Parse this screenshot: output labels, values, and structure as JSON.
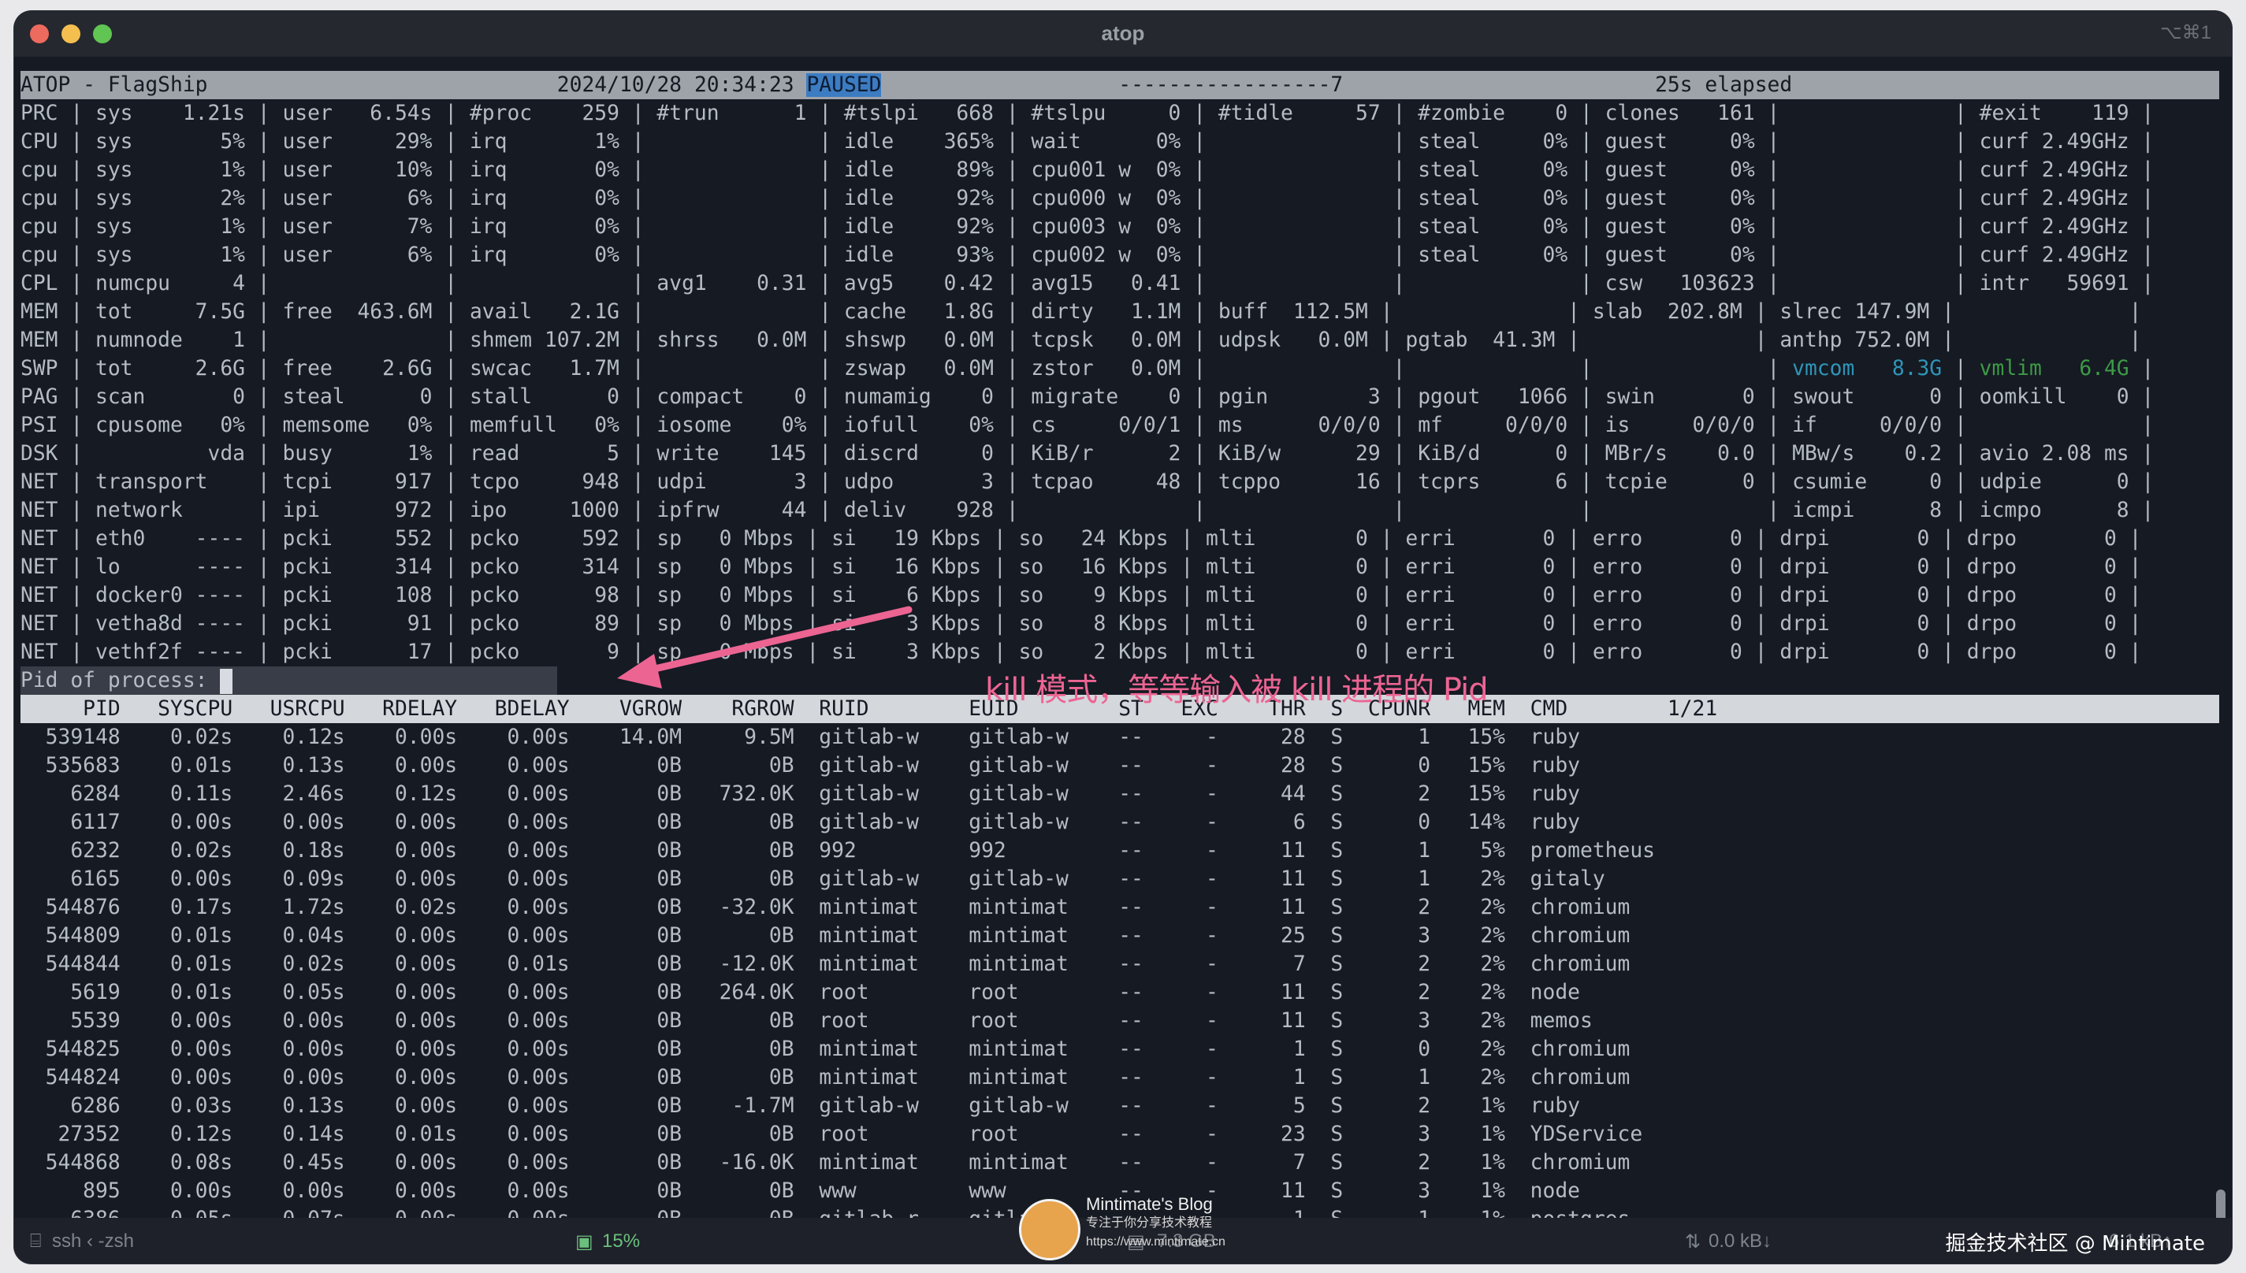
{
  "window": {
    "title": "atop",
    "shortcut": "⌥⌘1"
  },
  "header_line": {
    "prefix": "ATOP - FlagShip",
    "datetime": "2024/10/28 20:34:23",
    "paused": "PAUSED",
    "dashes": "-----------------7",
    "elapsed": "25s elapsed"
  },
  "system_rows": [
    "PRC | sys    1.21s | user   6.54s | #proc    259 | #trun      1 | #tslpi   668 | #tslpu     0 | #tidle     57 | #zombie    0 | clones   161 |              | #exit    119 |",
    "CPU | sys       5% | user     29% | irq       1% |              | idle    365% | wait      0% |               | steal     0% | guest     0% |              | curf 2.49GHz |",
    "cpu | sys       1% | user     10% | irq       0% |              | idle     89% | cpu001 w  0% |               | steal     0% | guest     0% |              | curf 2.49GHz |",
    "cpu | sys       2% | user      6% | irq       0% |              | idle     92% | cpu000 w  0% |               | steal     0% | guest     0% |              | curf 2.49GHz |",
    "cpu | sys       1% | user      7% | irq       0% |              | idle     92% | cpu003 w  0% |               | steal     0% | guest     0% |              | curf 2.49GHz |",
    "cpu | sys       1% | user      6% | irq       0% |              | idle     93% | cpu002 w  0% |               | steal     0% | guest     0% |              | curf 2.49GHz |",
    "CPL | numcpu     4 |              |              | avg1    0.31 | avg5    0.42 | avg15   0.41 |               |              | csw   103623 |              | intr   59691 |",
    "MEM | tot     7.5G | free  463.6M | avail   2.1G |              | cache   1.8G | dirty   1.1M | buff  112.5M |              | slab  202.8M | slrec 147.9M |              |",
    "MEM | numnode    1 |              | shmem 107.2M | shrss   0.0M | shswp   0.0M | tcpsk   0.0M | udpsk   0.0M | pgtab  41.3M |              | anthp 752.0M |              |",
    "SWP | tot     2.6G | free    2.6G | swcac   1.7M |              | zswap   0.0M | zstor   0.0M |               |              |              | ",
    "PAG | scan       0 | steal      0 | stall      0 | compact    0 | numamig    0 | migrate    0 | pgin        3 | pgout   1066 | swin       0 | swout      0 | oomkill    0 |",
    "PSI | cpusome   0% | memsome   0% | memfull   0% | iosome    0% | iofull    0% | cs     0/0/1 | ms      0/0/0 | mf     0/0/0 | is     0/0/0 | if     0/0/0 |              |",
    "DSK |          vda | busy      1% | read       5 | write    145 | discrd     0 | KiB/r      2 | KiB/w      29 | KiB/d      0 | MBr/s    0.0 | MBw/s    0.2 | avio 2.08 ms |",
    "NET | transport    | tcpi     917 | tcpo     948 | udpi       3 | udpo       3 | tcpao     48 | tcppo      16 | tcprs      6 | tcpie      0 | csumie     0 | udpie      0 |",
    "NET | network      | ipi      972 | ipo     1000 | ipfrw     44 | deliv    928 |              |               |              |              | icmpi      8 | icmpo      8 |",
    "NET | eth0    ---- | pcki     552 | pcko     592 | sp   0 Mbps | si   19 Kbps | so   24 Kbps | mlti        0 | erri       0 | erro       0 | drpi       0 | drpo       0 |",
    "NET | lo      ---- | pcki     314 | pcko     314 | sp   0 Mbps | si   16 Kbps | so   16 Kbps | mlti        0 | erri       0 | erro       0 | drpi       0 | drpo       0 |",
    "NET | docker0 ---- | pcki     108 | pcko      98 | sp   0 Mbps | si    6 Kbps | so    9 Kbps | mlti        0 | erri       0 | erro       0 | drpi       0 | drpo       0 |",
    "NET | vetha8d ---- | pcki      91 | pcko      89 | sp   0 Mbps | si    3 Kbps | so    8 Kbps | mlti        0 | erri       0 | erro       0 | drpi       0 | drpo       0 |",
    "NET | vethf2f ---- | pcki      17 | pcko       9 | sp   0 Mbps | si    3 Kbps | so    2 Kbps | mlti        0 | erri       0 | erro       0 | drpi       0 | drpo       0 |"
  ],
  "swp_tail": {
    "vmcom": "vmcom   8.3G",
    "sep": " | ",
    "vmlim": "vmlim   6.4G",
    "end": " |"
  },
  "prompt": {
    "label": "Pid of process: "
  },
  "process_header": "     PID   SYSCPU   USRCPU   RDELAY   BDELAY    VGROW    RGROW  RUID        EUID        ST   EXC    THR  S  CPUNR   MEM  CMD        1/21",
  "processes": [
    "  539148    0.02s    0.12s    0.00s    0.00s    14.0M     9.5M  gitlab-w    gitlab-w    --     -     28  S      1   15%  ruby",
    "  535683    0.01s    0.13s    0.00s    0.00s       0B       0B  gitlab-w    gitlab-w    --     -     28  S      0   15%  ruby",
    "    6284    0.11s    2.46s    0.12s    0.00s       0B   732.0K  gitlab-w    gitlab-w    --     -     44  S      2   15%  ruby",
    "    6117    0.00s    0.00s    0.00s    0.00s       0B       0B  gitlab-w    gitlab-w    --     -      6  S      0   14%  ruby",
    "    6232    0.02s    0.18s    0.00s    0.00s       0B       0B  992         992         --     -     11  S      1    5%  prometheus",
    "    6165    0.00s    0.09s    0.00s    0.00s       0B       0B  gitlab-w    gitlab-w    --     -     11  S      1    2%  gitaly",
    "  544876    0.17s    1.72s    0.02s    0.00s       0B   -32.0K  mintimat    mintimat    --     -     11  S      2    2%  chromium",
    "  544809    0.01s    0.04s    0.00s    0.00s       0B       0B  mintimat    mintimat    --     -     25  S      3    2%  chromium",
    "  544844    0.01s    0.02s    0.00s    0.01s       0B   -12.0K  mintimat    mintimat    --     -      7  S      2    2%  chromium",
    "    5619    0.01s    0.05s    0.00s    0.00s       0B   264.0K  root        root        --     -     11  S      2    2%  node",
    "    5539    0.00s    0.00s    0.00s    0.00s       0B       0B  root        root        --     -     11  S      3    2%  memos",
    "  544825    0.00s    0.00s    0.00s    0.00s       0B       0B  mintimat    mintimat    --     -      1  S      0    2%  chromium",
    "  544824    0.00s    0.00s    0.00s    0.00s       0B       0B  mintimat    mintimat    --     -      1  S      1    2%  chromium",
    "    6286    0.03s    0.13s    0.00s    0.00s       0B    -1.7M  gitlab-w    gitlab-w    --     -      5  S      2    1%  ruby",
    "   27352    0.12s    0.14s    0.01s    0.00s       0B       0B  root        root        --     -     23  S      3    1%  YDService",
    "  544868    0.08s    0.45s    0.00s    0.00s       0B   -16.0K  mintimat    mintimat    --     -      7  S      2    1%  chromium",
    "     895    0.00s    0.00s    0.00s    0.00s       0B       0B  www         www         --     -     11  S      3    1%  node",
    "    6386    0.05s    0.07s    0.00s    0.00s       0B       0B  gitlab-r    gitlab-r    --     -      1  S      1    1%  postgres"
  ],
  "annotation": {
    "text": "kill 模式，等等输入被 kill 进程的 Pid",
    "color": "#ec6492"
  },
  "statusbar": {
    "session": "ssh ‹ -zsh",
    "cpu": "15%",
    "mem": "7.3 GB",
    "net_down": "0.0 kB↓",
    "net_up": "6.1 kB↑"
  },
  "watermark": {
    "title": "Mintimate's Blog",
    "subtitle": "专注于你分享技术教程",
    "url": "https://www.mintimate.cn"
  },
  "brand": "掘金技术社区 @ Mintimate",
  "colors": {
    "close": "#ed6a5e",
    "minimize": "#f5bf4f",
    "maximize": "#61c554",
    "paused_bg": "#3c7cc2"
  }
}
